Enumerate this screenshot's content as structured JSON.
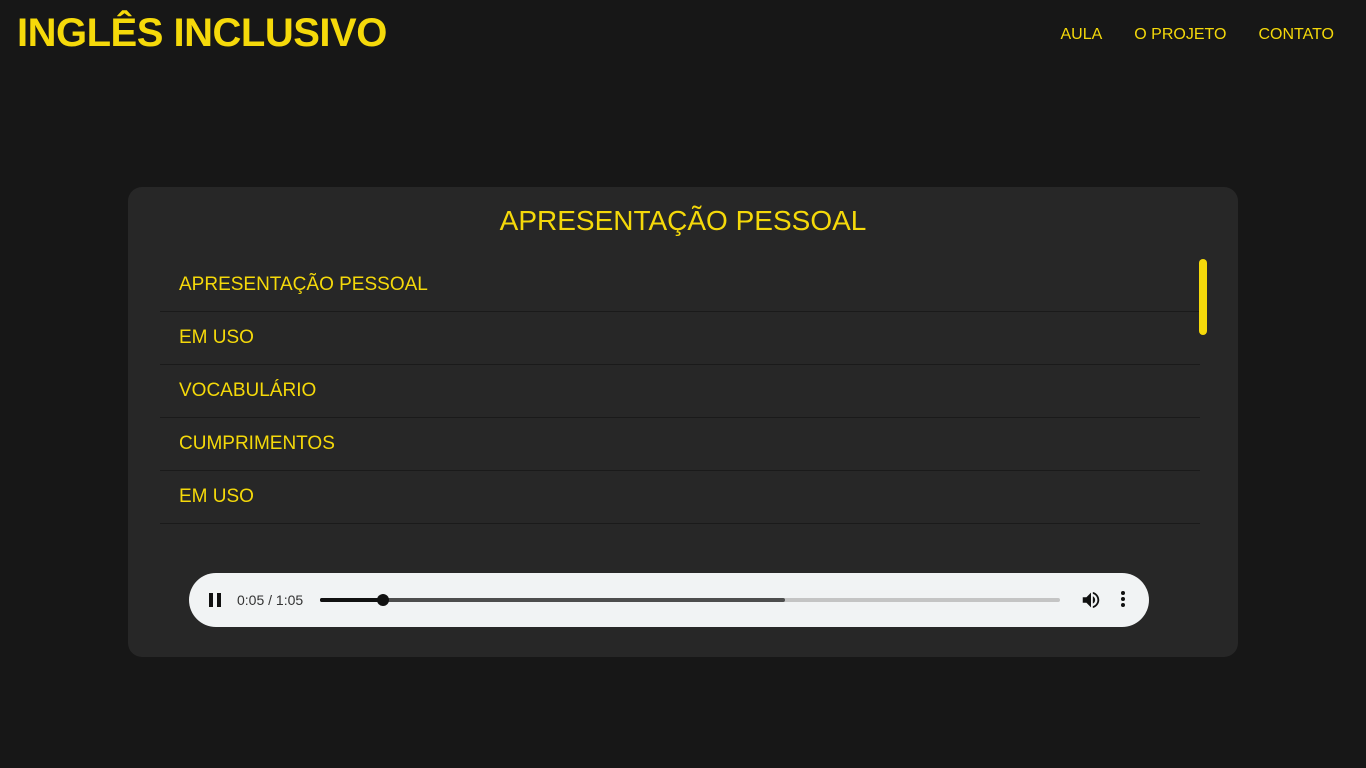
{
  "header": {
    "brand": "INGLÊS INCLUSIVO",
    "nav": [
      {
        "label": "AULA"
      },
      {
        "label": "O PROJETO"
      },
      {
        "label": "CONTATO"
      }
    ]
  },
  "lesson": {
    "title": "APRESENTAÇÃO PESSOAL",
    "items": [
      {
        "label": "APRESENTAÇÃO PESSOAL"
      },
      {
        "label": "EM USO"
      },
      {
        "label": "VOCABULÁRIO"
      },
      {
        "label": "CUMPRIMENTOS"
      },
      {
        "label": "EM USO"
      }
    ]
  },
  "audio_player": {
    "time_display": "0:05 / 1:05",
    "progress_fraction": 0.085,
    "buffered_fraction": 0.629,
    "state": "playing",
    "icons": {
      "play_pause": "pause-icon",
      "volume": "volume-icon",
      "more": "more-vert-icon"
    }
  },
  "colors": {
    "background": "#171717",
    "card": "#272727",
    "accent": "#f5d90a",
    "player": "#f1f3f4"
  }
}
